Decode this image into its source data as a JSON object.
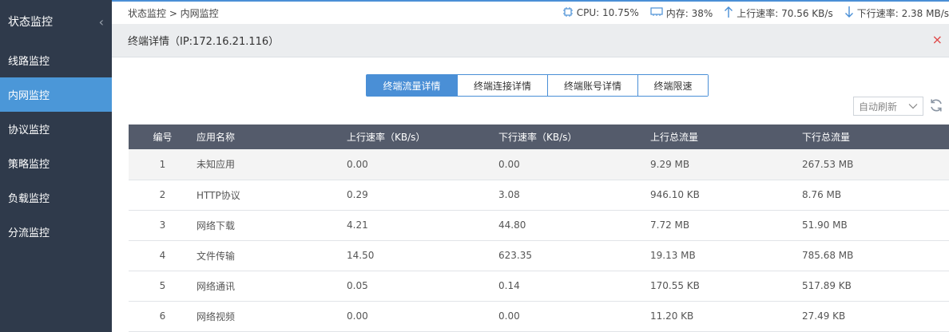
{
  "sidebar": {
    "title": "状态监控",
    "collapse_glyph": "‹",
    "items": [
      {
        "label": "线路监控",
        "active": false
      },
      {
        "label": "内网监控",
        "active": true
      },
      {
        "label": "协议监控",
        "active": false
      },
      {
        "label": "策略监控",
        "active": false
      },
      {
        "label": "负载监控",
        "active": false
      },
      {
        "label": "分流监控",
        "active": false
      }
    ]
  },
  "topbar": {
    "breadcrumb": "状态监控 > 内网监控",
    "cpu": "CPU: 10.75%",
    "mem": "内存: 38%",
    "up": "上行速率: 70.56 KB/s",
    "down": "下行速率: 2.38 MB/s",
    "accent": "#4a8fd6"
  },
  "page": {
    "title": "终端详情（IP:172.16.21.116）",
    "close": "×"
  },
  "tabs": [
    "终端流量详情",
    "终端连接详情",
    "终端账号详情",
    "终端限速"
  ],
  "refresh": {
    "label": "自动刷新"
  },
  "table": {
    "headers": [
      "编号",
      "应用名称",
      "上行速率（KB/s）",
      "下行速率（KB/s）",
      "上行总流量",
      "下行总流量"
    ],
    "rows": [
      [
        "1",
        "未知应用",
        "0.00",
        "0.00",
        "9.29 MB",
        "267.53 MB"
      ],
      [
        "2",
        "HTTP协议",
        "0.29",
        "3.08",
        "946.10 KB",
        "8.76 MB"
      ],
      [
        "3",
        "网络下载",
        "4.21",
        "44.80",
        "7.72 MB",
        "51.90 MB"
      ],
      [
        "4",
        "文件传输",
        "14.50",
        "623.35",
        "19.13 MB",
        "785.68 MB"
      ],
      [
        "5",
        "网络通讯",
        "0.05",
        "0.14",
        "170.55 KB",
        "517.89 KB"
      ],
      [
        "6",
        "网络视频",
        "0.00",
        "0.00",
        "11.20 KB",
        "27.49 KB"
      ]
    ]
  }
}
